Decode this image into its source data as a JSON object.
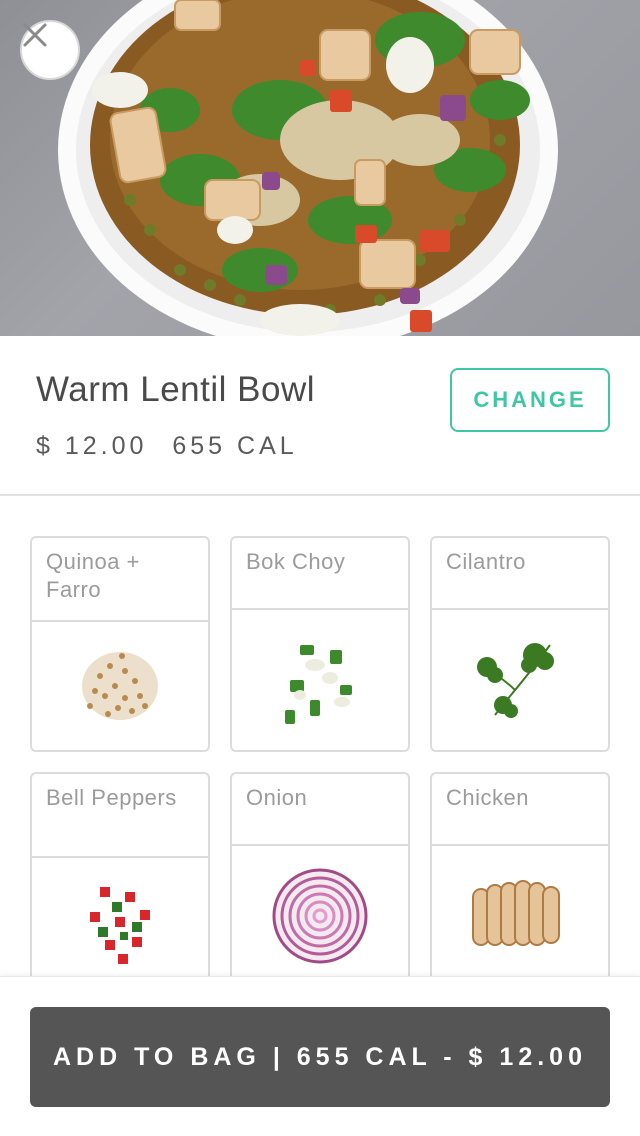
{
  "hero": {
    "image_icon": "lentil-bowl-photo"
  },
  "close": {
    "icon": "close-icon"
  },
  "item": {
    "name": "Warm Lentil Bowl",
    "price": "$ 12.00",
    "calories": "655 CAL",
    "change_label": "CHANGE"
  },
  "ingredients": [
    {
      "label": "Quinoa + Farro",
      "icon": "grain-icon"
    },
    {
      "label": "Bok Choy",
      "icon": "bok-choy-icon"
    },
    {
      "label": "Cilantro",
      "icon": "cilantro-icon"
    },
    {
      "label": "Bell Peppers",
      "icon": "bell-pepper-icon"
    },
    {
      "label": "Onion",
      "icon": "onion-icon"
    },
    {
      "label": "Chicken",
      "icon": "chicken-icon"
    }
  ],
  "cart": {
    "add_label": "ADD TO BAG | 655 CAL - $ 12.00"
  },
  "colors": {
    "accent": "#3fc7a3",
    "button_bg": "#555555"
  }
}
